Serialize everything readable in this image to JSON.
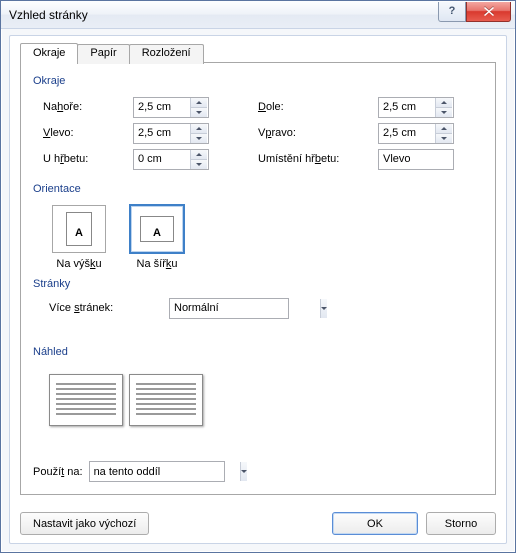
{
  "window": {
    "title": "Vzhled stránky"
  },
  "tabs": {
    "t0": "Okraje",
    "t1": "Papír",
    "t2": "Rozložení"
  },
  "groups": {
    "margins": "Okraje",
    "orientation": "Orientace",
    "pages": "Stránky",
    "preview": "Náhled"
  },
  "margins": {
    "top_label_pre": "Na",
    "top_label_u": "h",
    "top_label_post": "oře:",
    "top_value": "2,5 cm",
    "bottom_label_u": "D",
    "bottom_label_post": "ole:",
    "bottom_value": "2,5 cm",
    "left_label_u": "V",
    "left_label_post": "levo:",
    "left_value": "2,5 cm",
    "right_label_pre": "V",
    "right_label_u": "p",
    "right_label_post": "ravo:",
    "right_value": "2,5 cm",
    "gutter_label_pre": "U h",
    "gutter_label_u": "ř",
    "gutter_label_post": "betu:",
    "gutter_value": "0 cm",
    "gutterpos_label_pre": "Umístění hř",
    "gutterpos_label_u": "b",
    "gutterpos_label_post": "etu:",
    "gutterpos_value": "Vlevo"
  },
  "orientation": {
    "portrait_pre": "Na výš",
    "portrait_u": "k",
    "portrait_post": "u",
    "landscape_pre": "Na šíř",
    "landscape_u": "k",
    "landscape_post": "u"
  },
  "pages": {
    "multi_label_pre": "Více ",
    "multi_label_u": "s",
    "multi_label_post": "tránek:",
    "multi_value": "Normální"
  },
  "apply": {
    "label_pre": "Použí",
    "label_u": "t",
    "label_post": " na:",
    "value": "na tento oddíl"
  },
  "buttons": {
    "default": "Nastavit jako výchozí",
    "ok": "OK",
    "cancel": "Storno"
  }
}
